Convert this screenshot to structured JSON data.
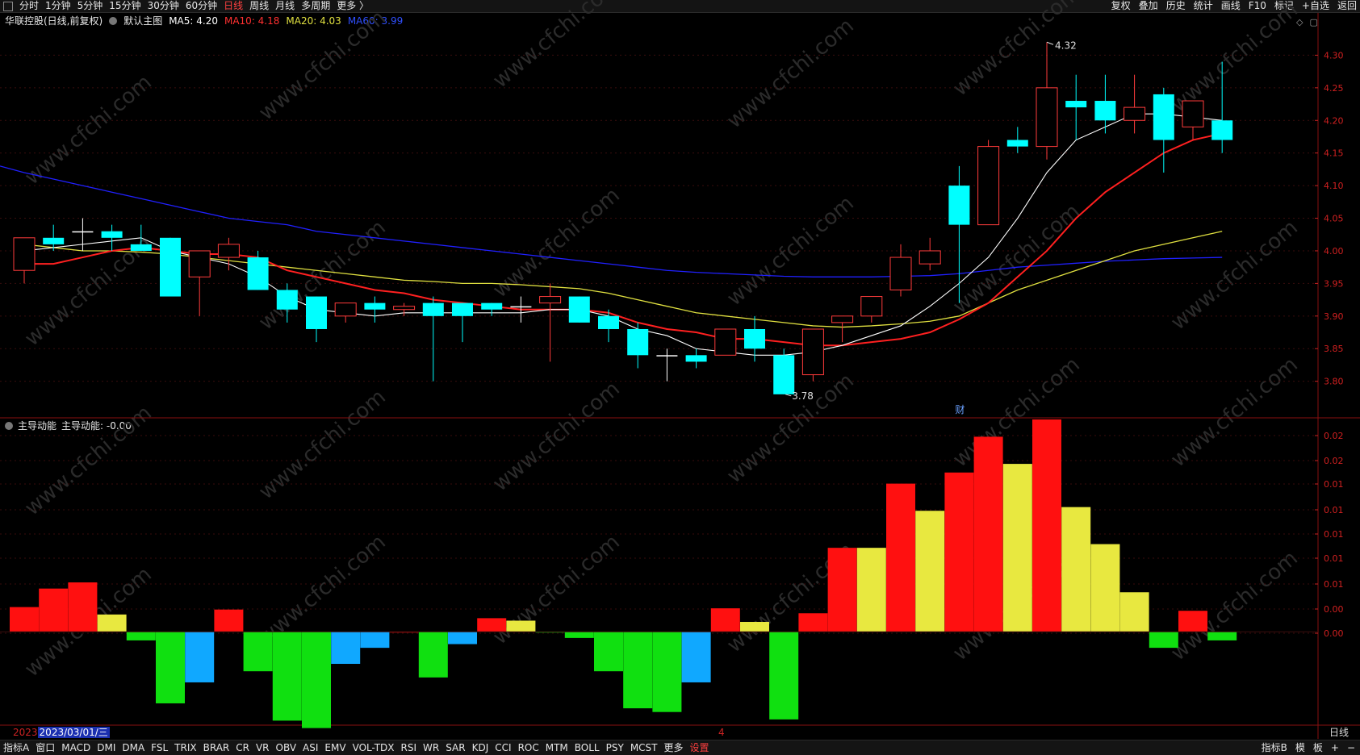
{
  "toolbar": {
    "left_items": [
      "分时",
      "1分钟",
      "5分钟",
      "15分钟",
      "30分钟",
      "60分钟",
      "日线",
      "周线",
      "月线",
      "多周期",
      "更多 〉"
    ],
    "active_item": "日线",
    "right_items": [
      "复权",
      "叠加",
      "历史",
      "统计",
      "画线",
      "F10",
      "标记",
      "+自选",
      "返回"
    ]
  },
  "main_info": {
    "stock": "华联控股(日线,前复权)",
    "chart_name": "默认主图",
    "ma5": "MA5: 4.20",
    "ma10": "MA10: 4.18",
    "ma20": "MA20: 4.03",
    "ma60": "MA60: 3.99"
  },
  "sub_info": {
    "name": "主导动能",
    "value": "主导动能: -0.00"
  },
  "date_bar": {
    "year": "2023",
    "date": "2023/03/01/三",
    "marker": "4",
    "period": "日线"
  },
  "bottom_toolbar": {
    "left_items": [
      "指标A",
      "窗口",
      "MACD",
      "DMI",
      "DMA",
      "FSL",
      "TRIX",
      "BRAR",
      "CR",
      "VR",
      "OBV",
      "ASI",
      "EMV",
      "VOL-TDX",
      "RSI",
      "WR",
      "SAR",
      "KDJ",
      "CCI",
      "ROC",
      "MTM",
      "BOLL",
      "PSY",
      "MCST",
      "更多",
      "设置"
    ],
    "right_items": [
      "指标B",
      "模",
      "板",
      "+",
      "−"
    ]
  },
  "annotations": {
    "high_label": "4.32",
    "low_label": "3.78",
    "cai_label": "财"
  },
  "watermark": "www.cfchi.com",
  "colors": {
    "up": "#ff3b3b",
    "down": "#00ffff",
    "ma5": "#ffffff",
    "ma10": "#ff2020",
    "ma20": "#e0e040",
    "ma60": "#2020ff",
    "bar_red": "#ff1010",
    "bar_yellow": "#e8e840",
    "bar_green": "#10e010",
    "bar_blue": "#10a8ff"
  },
  "chart_data": [
    {
      "type": "candlestick",
      "title": "华联控股(日线,前复权)",
      "y_ticks": [
        3.8,
        3.85,
        3.9,
        3.95,
        4.0,
        4.05,
        4.1,
        4.15,
        4.2,
        4.25,
        4.3
      ],
      "ylim": [
        3.76,
        4.35
      ],
      "candles": [
        {
          "o": 3.97,
          "h": 4.02,
          "l": 3.95,
          "c": 4.02
        },
        {
          "o": 4.02,
          "h": 4.04,
          "l": 4.0,
          "c": 4.01
        },
        {
          "o": 4.03,
          "h": 4.05,
          "l": 4.0,
          "c": 4.03
        },
        {
          "o": 4.03,
          "h": 4.04,
          "l": 4.0,
          "c": 4.02
        },
        {
          "o": 4.01,
          "h": 4.04,
          "l": 4.0,
          "c": 4.0
        },
        {
          "o": 4.02,
          "h": 4.02,
          "l": 3.93,
          "c": 3.93
        },
        {
          "o": 3.96,
          "h": 4.0,
          "l": 3.9,
          "c": 4.0
        },
        {
          "o": 3.99,
          "h": 4.02,
          "l": 3.97,
          "c": 4.01
        },
        {
          "o": 3.99,
          "h": 4.0,
          "l": 3.94,
          "c": 3.94
        },
        {
          "o": 3.94,
          "h": 3.95,
          "l": 3.89,
          "c": 3.91
        },
        {
          "o": 3.93,
          "h": 3.93,
          "l": 3.86,
          "c": 3.88
        },
        {
          "o": 3.9,
          "h": 3.92,
          "l": 3.89,
          "c": 3.92
        },
        {
          "o": 3.92,
          "h": 3.93,
          "l": 3.89,
          "c": 3.91
        },
        {
          "o": 3.91,
          "h": 3.92,
          "l": 3.9,
          "c": 3.915
        },
        {
          "o": 3.92,
          "h": 3.93,
          "l": 3.8,
          "c": 3.9
        },
        {
          "o": 3.92,
          "h": 3.92,
          "l": 3.86,
          "c": 3.9
        },
        {
          "o": 3.92,
          "h": 3.92,
          "l": 3.9,
          "c": 3.91
        },
        {
          "o": 3.915,
          "h": 3.93,
          "l": 3.89,
          "c": 3.915
        },
        {
          "o": 3.92,
          "h": 3.95,
          "l": 3.83,
          "c": 3.93
        },
        {
          "o": 3.93,
          "h": 3.93,
          "l": 3.89,
          "c": 3.89
        },
        {
          "o": 3.9,
          "h": 3.91,
          "l": 3.86,
          "c": 3.88
        },
        {
          "o": 3.88,
          "h": 3.89,
          "l": 3.82,
          "c": 3.84
        },
        {
          "o": 3.84,
          "h": 3.85,
          "l": 3.8,
          "c": 3.84
        },
        {
          "o": 3.84,
          "h": 3.85,
          "l": 3.82,
          "c": 3.83
        },
        {
          "o": 3.84,
          "h": 3.88,
          "l": 3.84,
          "c": 3.88
        },
        {
          "o": 3.88,
          "h": 3.9,
          "l": 3.83,
          "c": 3.85
        },
        {
          "o": 3.84,
          "h": 3.85,
          "l": 3.78,
          "c": 3.78
        },
        {
          "o": 3.81,
          "h": 3.88,
          "l": 3.8,
          "c": 3.88
        },
        {
          "o": 3.89,
          "h": 3.9,
          "l": 3.86,
          "c": 3.9
        },
        {
          "o": 3.9,
          "h": 3.93,
          "l": 3.89,
          "c": 3.93
        },
        {
          "o": 3.94,
          "h": 4.01,
          "l": 3.93,
          "c": 3.99
        },
        {
          "o": 3.98,
          "h": 4.02,
          "l": 3.97,
          "c": 4.0
        },
        {
          "o": 4.1,
          "h": 4.13,
          "l": 3.92,
          "c": 4.04
        },
        {
          "o": 4.04,
          "h": 4.17,
          "l": 4.04,
          "c": 4.16
        },
        {
          "o": 4.17,
          "h": 4.19,
          "l": 4.15,
          "c": 4.16
        },
        {
          "o": 4.16,
          "h": 4.32,
          "l": 4.14,
          "c": 4.25
        },
        {
          "o": 4.23,
          "h": 4.27,
          "l": 4.17,
          "c": 4.22
        },
        {
          "o": 4.23,
          "h": 4.27,
          "l": 4.18,
          "c": 4.2
        },
        {
          "o": 4.2,
          "h": 4.27,
          "l": 4.18,
          "c": 4.22
        },
        {
          "o": 4.24,
          "h": 4.25,
          "l": 4.12,
          "c": 4.17
        },
        {
          "o": 4.19,
          "h": 4.23,
          "l": 4.17,
          "c": 4.23
        },
        {
          "o": 4.2,
          "h": 4.29,
          "l": 4.15,
          "c": 4.17
        }
      ],
      "ma5": [
        4.0,
        4.005,
        4.01,
        4.015,
        4.02,
        4.0,
        3.99,
        3.98,
        3.96,
        3.93,
        3.91,
        3.905,
        3.9,
        3.905,
        3.905,
        3.905,
        3.905,
        3.905,
        3.91,
        3.91,
        3.9,
        3.88,
        3.87,
        3.85,
        3.845,
        3.84,
        3.84,
        3.845,
        3.855,
        3.87,
        3.885,
        3.915,
        3.95,
        3.99,
        4.05,
        4.12,
        4.17,
        4.19,
        4.21,
        4.21,
        4.205,
        4.2
      ],
      "ma10": [
        3.98,
        3.98,
        3.99,
        4.0,
        4.005,
        4.0,
        3.995,
        3.995,
        3.99,
        3.97,
        3.96,
        3.95,
        3.94,
        3.935,
        3.925,
        3.92,
        3.915,
        3.91,
        3.91,
        3.91,
        3.905,
        3.89,
        3.88,
        3.875,
        3.865,
        3.865,
        3.86,
        3.855,
        3.855,
        3.86,
        3.865,
        3.875,
        3.895,
        3.92,
        3.96,
        4.0,
        4.05,
        4.09,
        4.12,
        4.15,
        4.17,
        4.18
      ],
      "ma20": [
        4.01,
        4.005,
        4.0,
        4.0,
        3.998,
        3.995,
        3.99,
        3.985,
        3.98,
        3.975,
        3.97,
        3.965,
        3.96,
        3.955,
        3.953,
        3.95,
        3.95,
        3.948,
        3.945,
        3.942,
        3.935,
        3.925,
        3.915,
        3.905,
        3.9,
        3.895,
        3.89,
        3.885,
        3.883,
        3.885,
        3.888,
        3.892,
        3.9,
        3.92,
        3.94,
        3.955,
        3.97,
        3.985,
        4.0,
        4.01,
        4.02,
        4.03
      ],
      "ma60": [
        4.12,
        4.11,
        4.1,
        4.09,
        4.08,
        4.07,
        4.06,
        4.05,
        4.045,
        4.04,
        4.03,
        4.025,
        4.02,
        4.015,
        4.01,
        4.005,
        4.0,
        3.995,
        3.99,
        3.985,
        3.98,
        3.975,
        3.97,
        3.967,
        3.965,
        3.963,
        3.961,
        3.96,
        3.96,
        3.96,
        3.961,
        3.962,
        3.965,
        3.97,
        3.975,
        3.978,
        3.981,
        3.984,
        3.986,
        3.988,
        3.989,
        3.99
      ]
    },
    {
      "type": "bar",
      "title": "主导动能",
      "y_ticks": [
        0.0,
        0.0,
        0.01,
        0.01,
        0.01,
        0.01,
        0.01,
        0.02,
        0.02
      ],
      "ylim": [
        -0.0075,
        0.0172
      ],
      "values": [
        0.002,
        0.0035,
        0.004,
        0.0014,
        -0.0007,
        -0.0058,
        -0.0041,
        0.0018,
        -0.0032,
        -0.0072,
        -0.0078,
        -0.0026,
        -0.0013,
        0.0,
        -0.0037,
        -0.001,
        0.0011,
        0.0009,
        0.0,
        -0.0005,
        -0.0032,
        -0.0062,
        -0.0065,
        -0.0041,
        0.0019,
        0.0008,
        -0.0071,
        0.0015,
        0.0068,
        0.0068,
        0.012,
        0.0098,
        0.0129,
        0.0158,
        0.0136,
        0.0172,
        0.0101,
        0.0071,
        0.0032,
        -0.0013,
        0.0017,
        -0.0007
      ],
      "colors": [
        "red",
        "red",
        "red",
        "yellow",
        "green",
        "green",
        "blue",
        "red",
        "green",
        "green",
        "green",
        "blue",
        "blue",
        "red",
        "green",
        "blue",
        "red",
        "yellow",
        "green",
        "green",
        "green",
        "green",
        "green",
        "blue",
        "red",
        "yellow",
        "green",
        "red",
        "red",
        "yellow",
        "red",
        "yellow",
        "red",
        "red",
        "yellow",
        "red",
        "yellow",
        "yellow",
        "yellow",
        "green",
        "red",
        "green"
      ]
    }
  ]
}
